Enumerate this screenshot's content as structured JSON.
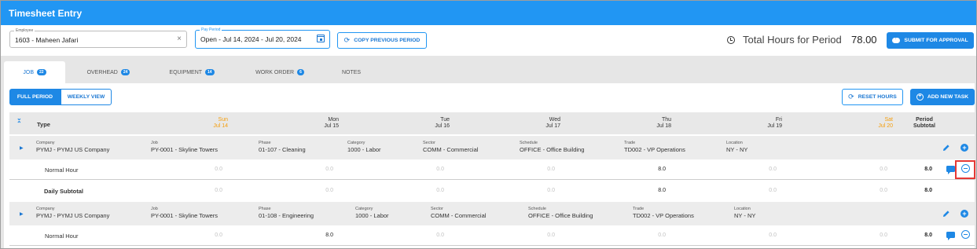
{
  "app": {
    "title": "Timesheet Entry"
  },
  "employee": {
    "label": "Employee",
    "value": "1603 - Maheen Jafari"
  },
  "pay_period": {
    "label": "Pay Period",
    "value": "Open - Jul 14, 2024 - Jul 20, 2024"
  },
  "copy_previous_label": "COPY PREVIOUS PERIOD",
  "total": {
    "label": "Total Hours for Period",
    "value": "78.00"
  },
  "submit_label": "SUBMIT FOR APPROVAL",
  "tabs": [
    {
      "label": "JOB",
      "count": "22",
      "active": true
    },
    {
      "label": "OVERHEAD",
      "count": "24"
    },
    {
      "label": "EQUIPMENT",
      "count": "14"
    },
    {
      "label": "WORK ORDER",
      "count": "6"
    },
    {
      "label": "NOTES"
    }
  ],
  "view": {
    "full_period": "FULL PERIOD",
    "weekly": "WEEKLY VIEW"
  },
  "reset_label": "RESET HOURS",
  "add_task_label": "ADD NEW TASK",
  "grid_header": {
    "type": "Type",
    "days": [
      {
        "dow": "Sun",
        "date": "Jul 14",
        "weekend": true
      },
      {
        "dow": "Mon",
        "date": "Jul 15"
      },
      {
        "dow": "Tue",
        "date": "Jul 16"
      },
      {
        "dow": "Wed",
        "date": "Jul 17"
      },
      {
        "dow": "Thu",
        "date": "Jul 18"
      },
      {
        "dow": "Fri",
        "date": "Jul 19"
      },
      {
        "dow": "Sat",
        "date": "Jul 20",
        "weekend": true
      }
    ],
    "subtotal_line1": "Period",
    "subtotal_line2": "Subtotal"
  },
  "field_labels": {
    "company": "Company",
    "job": "Job",
    "phase": "Phase",
    "category": "Category",
    "sector": "Sector",
    "schedule": "Schedule",
    "trade": "Trade",
    "location": "Location"
  },
  "tasks": [
    {
      "company": "PYMJ - PYMJ US Company",
      "job": "PY-0001 - Skyline Towers",
      "phase": "01-107 - Cleaning",
      "category": "1000 - Labor",
      "sector": "COMM - Commercial",
      "schedule": "OFFICE - Office Building",
      "trade": "TD002 - VP Operations",
      "location": "NY - NY",
      "rows": [
        {
          "label": "Normal Hour",
          "values": [
            "0.0",
            "0.0",
            "0.0",
            "0.0",
            "8.0",
            "0.0",
            "0.0"
          ],
          "subtotal": "8.0"
        },
        {
          "label": "Daily Subtotal",
          "values": [
            "0.0",
            "0.0",
            "0.0",
            "0.0",
            "8.0",
            "0.0",
            "0.0"
          ],
          "subtotal": "8.0"
        }
      ]
    },
    {
      "company": "PYMJ - PYMJ US Company",
      "job": "PY-0001 - Skyline Towers",
      "phase": "01-108 - Engineering",
      "category": "1000 - Labor",
      "sector": "COMM - Commercial",
      "schedule": "OFFICE - Office Building",
      "trade": "TD002 - VP Operations",
      "location": "NY - NY",
      "rows": [
        {
          "label": "Normal Hour",
          "values": [
            "0.0",
            "8.0",
            "0.0",
            "0.0",
            "0.0",
            "0.0",
            "0.0"
          ],
          "subtotal": "8.0"
        }
      ]
    }
  ],
  "colors": {
    "primary": "#1e88e5",
    "weekend": "#f59e0b",
    "highlight": "#e53935"
  }
}
